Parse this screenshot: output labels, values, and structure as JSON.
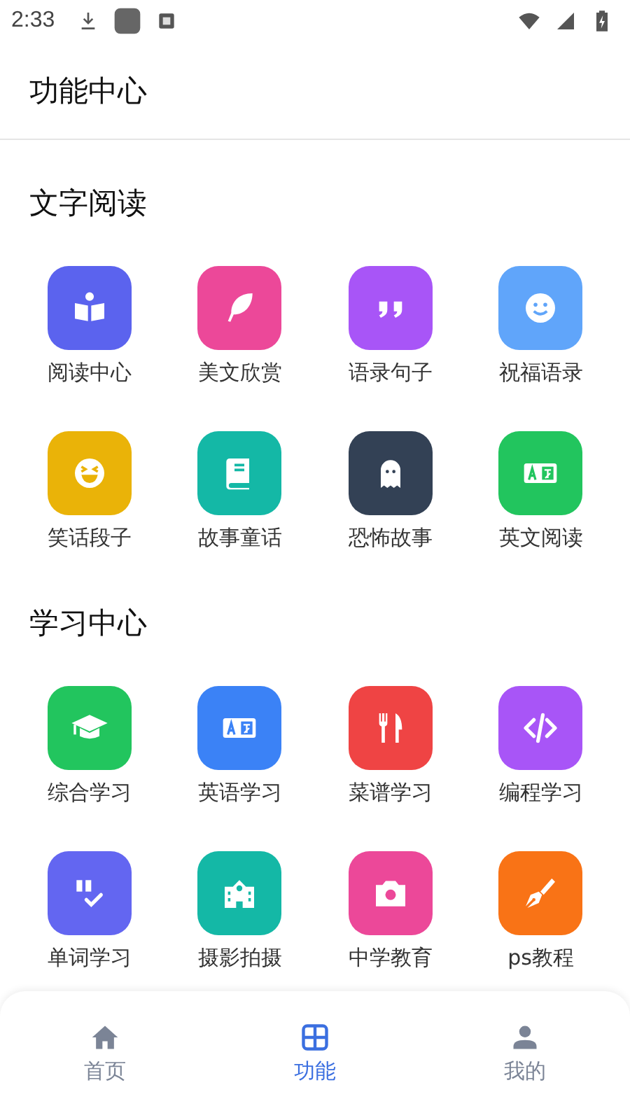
{
  "status_bar": {
    "time": "2:33"
  },
  "header": {
    "title": "功能中心"
  },
  "sections": [
    {
      "title": "文字阅读",
      "items": [
        {
          "label": "阅读中心",
          "kind": "reader",
          "color": "#5b63ee"
        },
        {
          "label": "美文欣赏",
          "kind": "feather",
          "color": "#ec4899"
        },
        {
          "label": "语录句子",
          "kind": "quote",
          "color": "#a855f7"
        },
        {
          "label": "祝福语录",
          "kind": "smile",
          "color": "#60a5fa"
        },
        {
          "label": "笑话段子",
          "kind": "laugh",
          "color": "#eab308"
        },
        {
          "label": "故事童话",
          "kind": "book",
          "color": "#14b8a6"
        },
        {
          "label": "恐怖故事",
          "kind": "ghost",
          "color": "#334155"
        },
        {
          "label": "英文阅读",
          "kind": "translate",
          "color": "#22c55e"
        }
      ]
    },
    {
      "title": "学习中心",
      "items": [
        {
          "label": "综合学习",
          "kind": "cap",
          "color": "#22c55e"
        },
        {
          "label": "英语学习",
          "kind": "translate",
          "color": "#3b82f6"
        },
        {
          "label": "菜谱学习",
          "kind": "cutlery",
          "color": "#ef4444"
        },
        {
          "label": "编程学习",
          "kind": "code",
          "color": "#a855f7"
        },
        {
          "label": "单词学习",
          "kind": "abcheck",
          "color": "#6366f1"
        },
        {
          "label": "摄影拍摄",
          "kind": "school",
          "color": "#14b8a6"
        },
        {
          "label": "中学教育",
          "kind": "camera",
          "color": "#ec4899"
        },
        {
          "label": "ps教程",
          "kind": "pen",
          "color": "#f97316"
        }
      ]
    }
  ],
  "bottom_nav": [
    {
      "label": "首页",
      "kind": "home",
      "selected": false
    },
    {
      "label": "功能",
      "kind": "grid",
      "selected": true
    },
    {
      "label": "我的",
      "kind": "person",
      "selected": false
    }
  ]
}
